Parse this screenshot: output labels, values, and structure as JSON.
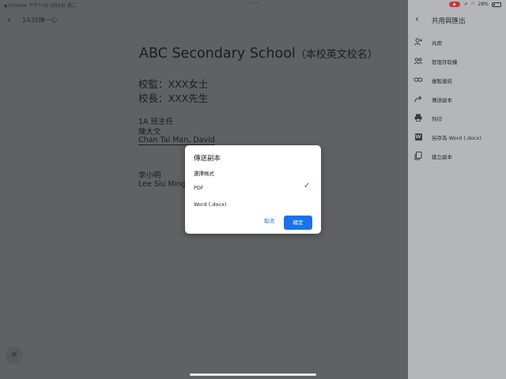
{
  "status_bar": {
    "left": "◀ Chrome   下午7:45   5月6日 週二",
    "dots": "•••",
    "battery": "28%"
  },
  "doc_topbar": {
    "back_icon": "chevron-left-icon",
    "title": "1A35陳一心"
  },
  "document": {
    "school_name_en": "ABC Secondary School",
    "school_name_cn": "（本校英文校名）",
    "supervisor": "校監：XXX女士",
    "principal": "校長：XXX先生",
    "class_teacher_title": "1A 班主任",
    "teacher_name_cn": "陳大文",
    "teacher_name_en": "Chan Tai Man, David",
    "student_name_cn": "李小明",
    "student_name_en": "Lee Siu Ming"
  },
  "panel": {
    "title": "共用與匯出",
    "items": [
      {
        "label": "共用",
        "icon": "person-add-icon"
      },
      {
        "label": "管理存取權",
        "icon": "people-icon"
      },
      {
        "label": "複製連結",
        "icon": "link-icon"
      },
      {
        "label": "傳送副本",
        "icon": "forward-arrow-icon"
      },
      {
        "label": "列印",
        "icon": "printer-icon"
      },
      {
        "label": "另存為 Word (.docx)",
        "icon": "word-icon"
      },
      {
        "label": "建立副本",
        "icon": "copy-icon"
      }
    ]
  },
  "dialog": {
    "title": "傳送副本",
    "subtitle": "選擇格式",
    "options": [
      {
        "label": "PDF",
        "selected": true
      },
      {
        "label": "Word (.docx)",
        "selected": false
      }
    ],
    "cancel_label": "取消",
    "ok_label": "確定"
  },
  "colors": {
    "accent": "#1a73e8",
    "overlay": "#5f6163",
    "panel": "#b5b6b8"
  }
}
